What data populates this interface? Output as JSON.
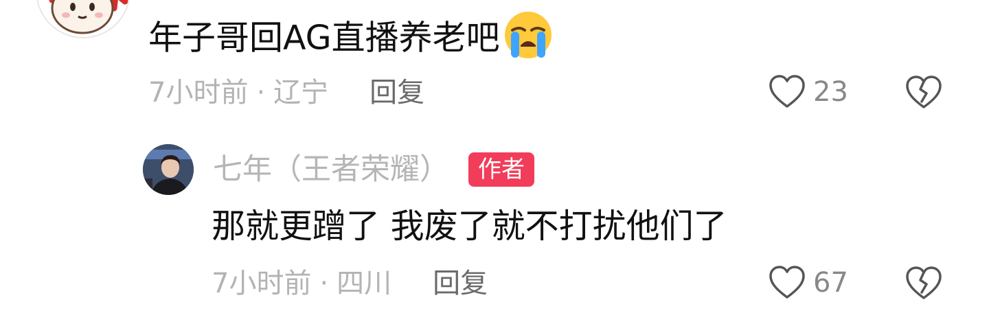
{
  "comment": {
    "text": "年子哥回AG直播养老吧",
    "emoji": "loudly-crying-face-emoji",
    "time": "7小时前",
    "separator": "·",
    "location": "辽宁",
    "reply_label": "回复",
    "likes": "23"
  },
  "reply": {
    "username": "七年（王者荣耀）",
    "badge": "作者",
    "text": "那就更蹭了 我废了就不打扰他们了",
    "time": "7小时前",
    "separator": "·",
    "location": "四川",
    "reply_label": "回复",
    "likes": "67"
  },
  "colors": {
    "badge": "#f23d5a",
    "meta_text": "#b3b3b3",
    "icon": "#555555"
  }
}
